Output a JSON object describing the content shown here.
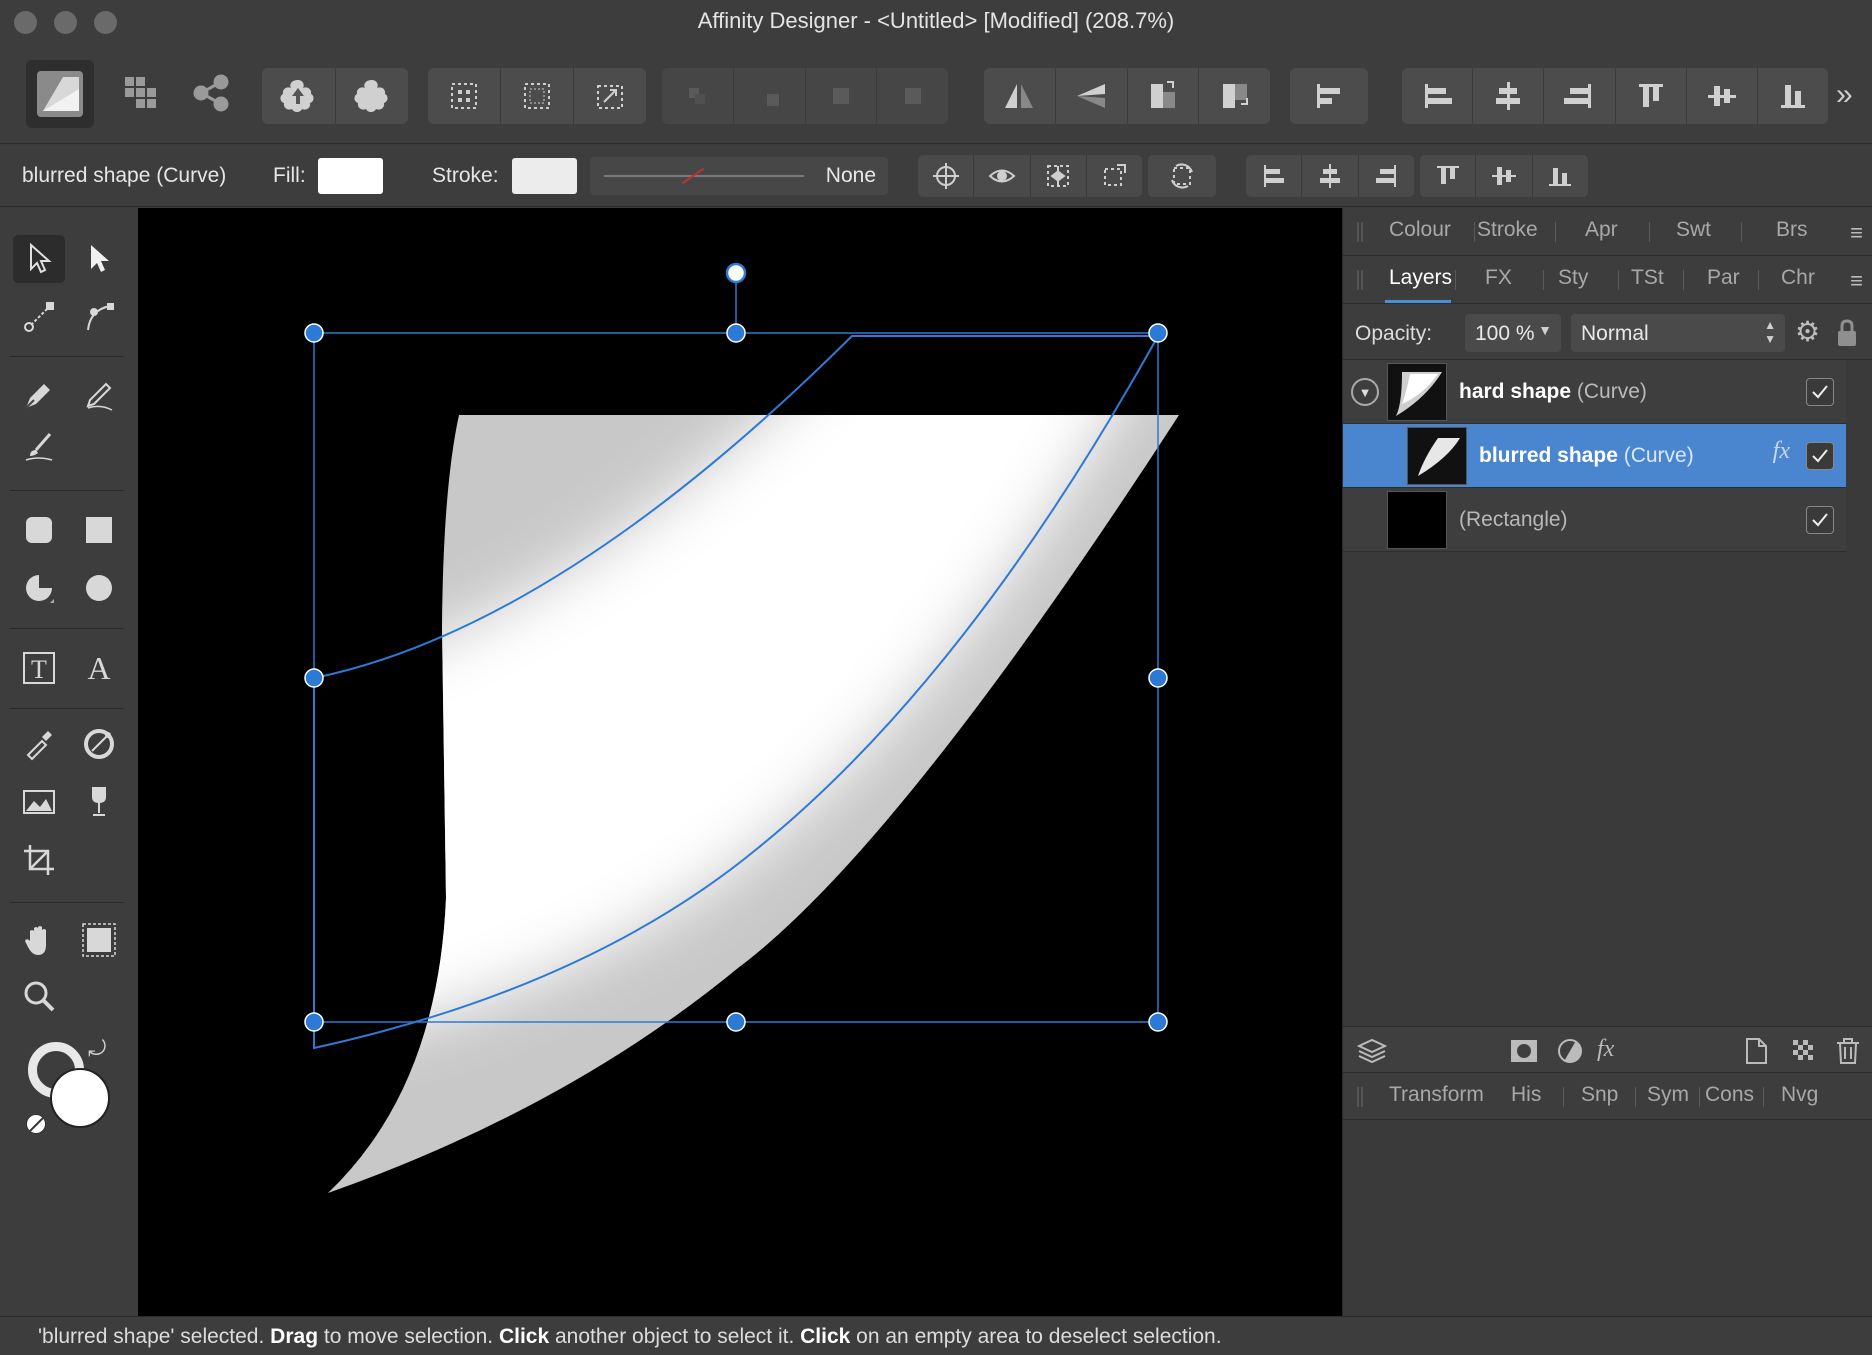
{
  "window": {
    "title": "Affinity Designer - <Untitled> [Modified] (208.7%)"
  },
  "context_toolbar": {
    "selection_label": "blurred shape (Curve)",
    "fill_label": "Fill:",
    "stroke_label": "Stroke:",
    "stroke_style_value": "None",
    "fill_color": "#ffffff",
    "stroke_color": "#ececec"
  },
  "top_panel": {
    "tabs": [
      "Colour",
      "Stroke",
      "Apr",
      "Swt",
      "Brs"
    ]
  },
  "layers_panel": {
    "tabs": [
      "Layers",
      "FX",
      "Sty",
      "TSt",
      "Par",
      "Chr"
    ],
    "opacity_label": "Opacity:",
    "opacity_value": "100 %",
    "blend_mode": "Normal",
    "layers": [
      {
        "name": "hard shape",
        "type": "(Curve)",
        "visible": true,
        "selected": false,
        "expanded": true
      },
      {
        "name": "blurred shape",
        "type": "(Curve)",
        "visible": true,
        "selected": true,
        "fx": "fx"
      },
      {
        "name": "",
        "type": "(Rectangle)",
        "visible": true,
        "selected": false
      }
    ]
  },
  "bottom_panel": {
    "tabs": [
      "Transform",
      "His",
      "Snp",
      "Sym",
      "Cons",
      "Nvg"
    ]
  },
  "status": {
    "part1": "'blurred shape' selected. ",
    "drag": "Drag",
    "part2": " to move selection. ",
    "click1": "Click",
    "part3": " another object to select it. ",
    "click2": "Click",
    "part4": " on an empty area to deselect selection."
  },
  "colors": {
    "accent": "#4a86d0",
    "selection_handle": "#2d7ad6",
    "artboard": "#000000",
    "shape_gray": "#c8c8c8"
  }
}
